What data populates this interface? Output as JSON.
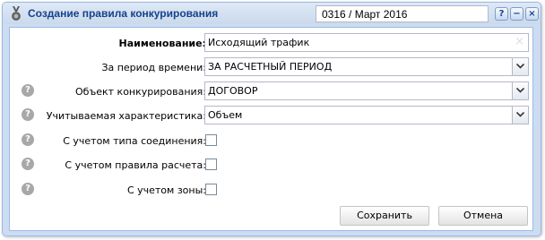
{
  "window": {
    "title": "Создание правила конкурирования",
    "period": "0316 / Март 2016",
    "tools": {
      "help": "?",
      "minimize": "−",
      "close": "×"
    }
  },
  "form": {
    "name": {
      "label": "Наименование:",
      "value": "Исходящий трафик"
    },
    "time_period": {
      "label": "За период времени:",
      "value": "ЗА РАСЧЕТНЫЙ ПЕРИОД"
    },
    "competition_object": {
      "label": "Объект конкурирования:",
      "value": "ДОГОВОР"
    },
    "characteristic": {
      "label": "Учитываемая характеристика:",
      "value": "Объем"
    },
    "connection_type": {
      "label": "С учетом типа соединения:",
      "checked": false
    },
    "calc_rule": {
      "label": "С учетом правила расчета:",
      "checked": false
    },
    "zone": {
      "label": "С учетом зоны:",
      "checked": false
    },
    "help_glyph": "?"
  },
  "buttons": {
    "save": "Сохранить",
    "cancel": "Отмена"
  },
  "colors": {
    "title": "#15428b",
    "frame": "#cddcf0",
    "border": "#99bbe8"
  }
}
